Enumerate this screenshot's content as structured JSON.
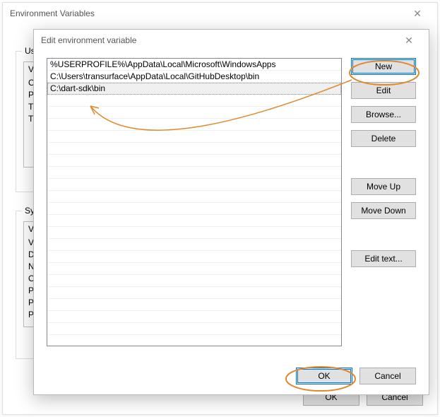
{
  "env_window": {
    "title": "Environment Variables",
    "user_section_label": "User",
    "system_section_label": "Syste",
    "col_variable_short": "Va",
    "user_rows": [
      "Or",
      "Pa",
      "TE",
      "TN"
    ],
    "system_rows": [
      "Va",
      "Dr",
      "NU",
      "OS",
      "Pa",
      "PA",
      "PR"
    ],
    "ok_label": "OK",
    "cancel_label": "Cancel"
  },
  "edit_window": {
    "title": "Edit environment variable",
    "entries": [
      "%USERPROFILE%\\AppData\\Local\\Microsoft\\WindowsApps",
      "C:\\Users\\transurface\\AppData\\Local\\GitHubDesktop\\bin",
      "C:\\dart-sdk\\bin"
    ],
    "selected_index": 2,
    "buttons": {
      "new": "New",
      "edit": "Edit",
      "browse": "Browse...",
      "delete": "Delete",
      "move_up": "Move Up",
      "move_down": "Move Down",
      "edit_text": "Edit text...",
      "ok": "OK",
      "cancel": "Cancel"
    }
  },
  "annotation": {
    "highlights": [
      "new-button",
      "ok-button-edit",
      "selected-entry"
    ],
    "arrow_from": "new-button",
    "arrow_to": "selected-entry",
    "color": "#e08a2e"
  }
}
